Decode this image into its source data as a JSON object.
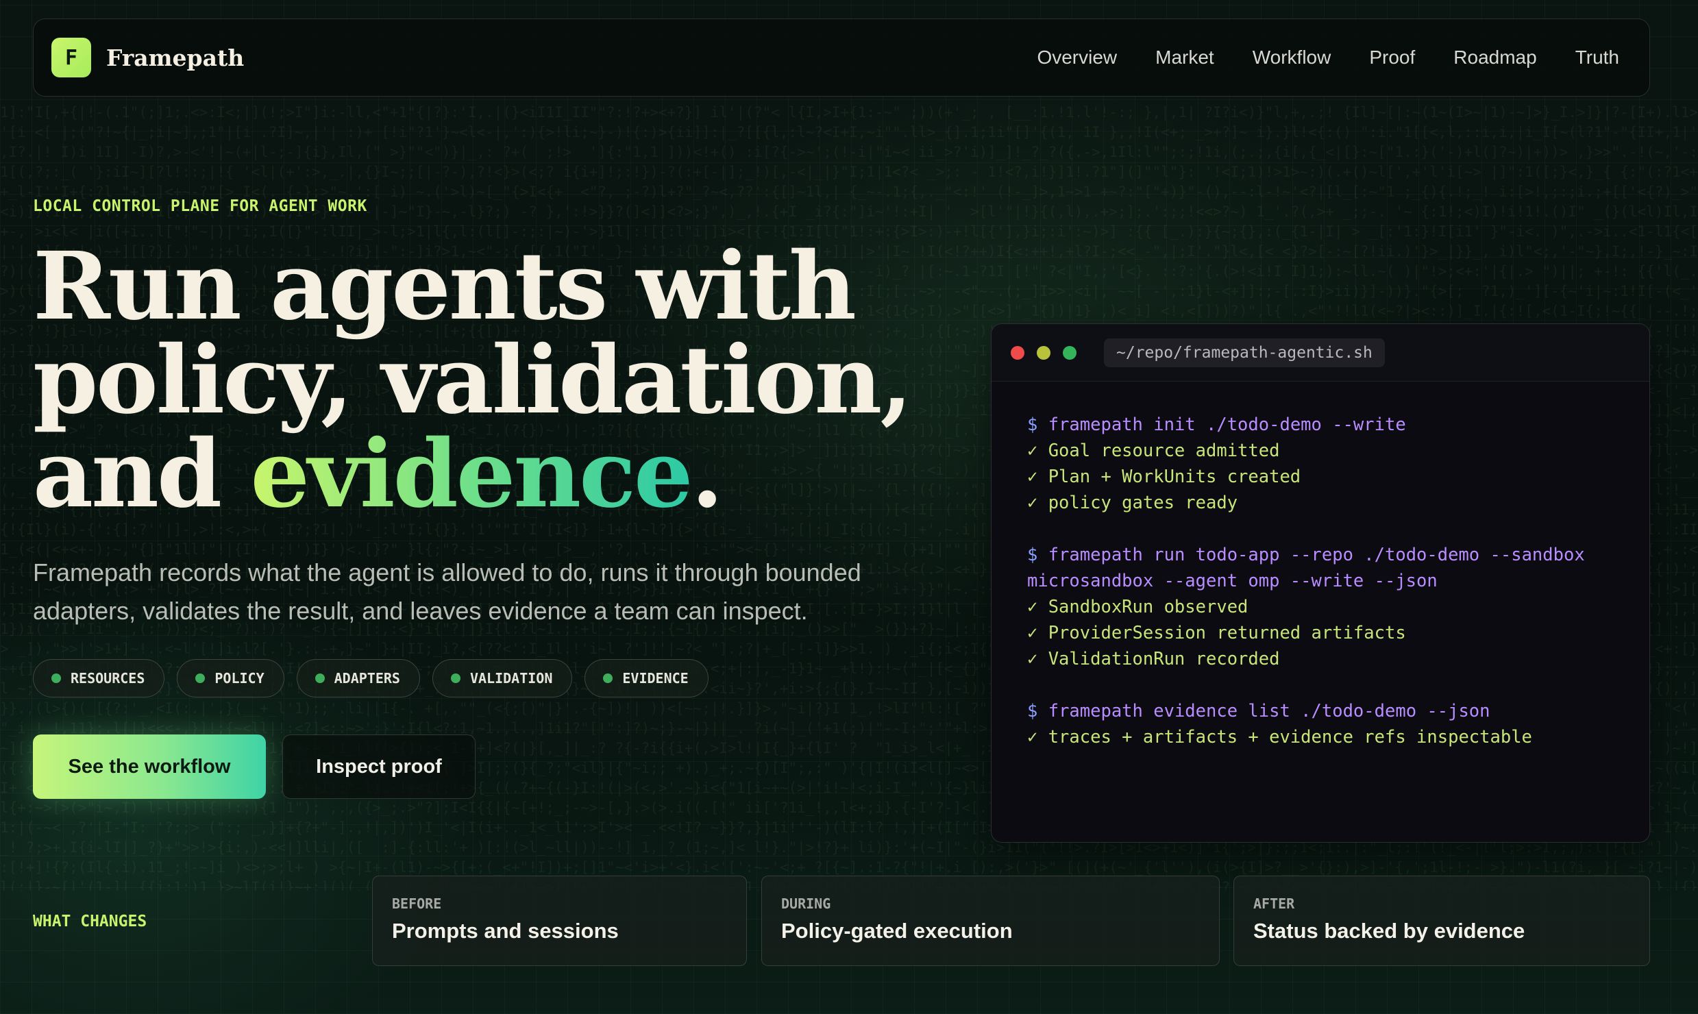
{
  "brand": {
    "logo_letter": "F",
    "name": "Framepath",
    "accent": "#c9f56c"
  },
  "nav": {
    "links": [
      "Overview",
      "Market",
      "Workflow",
      "Proof",
      "Roadmap",
      "Truth"
    ]
  },
  "hero": {
    "eyebrow": "LOCAL CONTROL PLANE FOR AGENT WORK",
    "headline_line1": "Run agents with",
    "headline_line2": "policy, validation,",
    "headline_line3_prefix": "and ",
    "headline_highlight": "evidence",
    "headline_suffix": ".",
    "lead": "Framepath records what the agent is allowed to do, runs it through bounded adapters, validates the result, and leaves evidence a team can inspect.",
    "pills": [
      "RESOURCES",
      "POLICY",
      "ADAPTERS",
      "VALIDATION",
      "EVIDENCE"
    ],
    "primary_cta": "See the workflow",
    "secondary_cta": "Inspect proof"
  },
  "terminal": {
    "path": "~/repo/framepath-agentic.sh",
    "dot_colors": [
      "#ef4b4b",
      "#b7c43a",
      "#35b55a"
    ],
    "lines": [
      {
        "type": "cmd",
        "prompt": "$ ",
        "command": "framepath",
        "args": " init ./todo-demo --write"
      },
      {
        "type": "ok",
        "text": "✓ Goal resource admitted"
      },
      {
        "type": "ok",
        "text": "✓ Plan + WorkUnits created"
      },
      {
        "type": "ok",
        "text": "✓ policy gates ready"
      },
      {
        "type": "blank"
      },
      {
        "type": "cmd",
        "prompt": "$ ",
        "command": "framepath",
        "args": " run todo-app --repo ./todo-demo --sandbox"
      },
      {
        "type": "cont",
        "text": "microsandbox --agent omp --write --json"
      },
      {
        "type": "ok",
        "text": "✓ SandboxRun observed"
      },
      {
        "type": "ok",
        "text": "✓ ProviderSession returned artifacts"
      },
      {
        "type": "ok",
        "text": "✓ ValidationRun recorded"
      },
      {
        "type": "blank"
      },
      {
        "type": "cmd",
        "prompt": "$ ",
        "command": "framepath",
        "args": " evidence list ./todo-demo --json"
      },
      {
        "type": "ok",
        "text": "✓ traces + artifacts + evidence refs inspectable"
      }
    ]
  },
  "changes": {
    "label": "WHAT CHANGES",
    "cards": [
      {
        "tag": "BEFORE",
        "title": "Prompts and sessions"
      },
      {
        "tag": "DURING",
        "title": "Policy-gated execution"
      },
      {
        "tag": "AFTER",
        "title": "Status backed by evidence"
      }
    ]
  }
}
